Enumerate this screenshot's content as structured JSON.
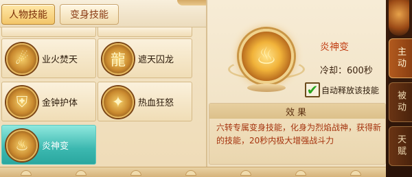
{
  "tabs": [
    {
      "label": "人物技能",
      "active": true
    },
    {
      "label": "变身技能",
      "active": false
    }
  ],
  "skills": [
    {
      "name": "业火焚天",
      "icon": "fire-meteor-icon"
    },
    {
      "name": "遮天囚龙",
      "icon": "dragon-cage-icon"
    },
    {
      "name": "金钟护体",
      "icon": "golden-bell-shield-icon"
    },
    {
      "name": "热血狂怒",
      "icon": "rage-warrior-icon"
    },
    {
      "name": "炎神变",
      "icon": "flame-god-icon",
      "selected": true
    }
  ],
  "detail": {
    "title": "炎神变",
    "cooldown": "冷却：600秒",
    "auto_cast_label": "自动释放该技能",
    "auto_cast_checked": true,
    "effect_header": "效果",
    "effect_text": "六转专属变身技能，化身为烈焰战神，获得新的技能，20秒内极大增强战斗力"
  },
  "side_tabs": [
    {
      "label": "主动",
      "active": true
    },
    {
      "label": "被动",
      "active": false
    },
    {
      "label": "天赋",
      "active": false
    }
  ],
  "colors": {
    "accent_title": "#c13d12",
    "effect_text": "#a5330e",
    "selected_bg": "#3cb8b0",
    "check_green": "#29a51f"
  }
}
